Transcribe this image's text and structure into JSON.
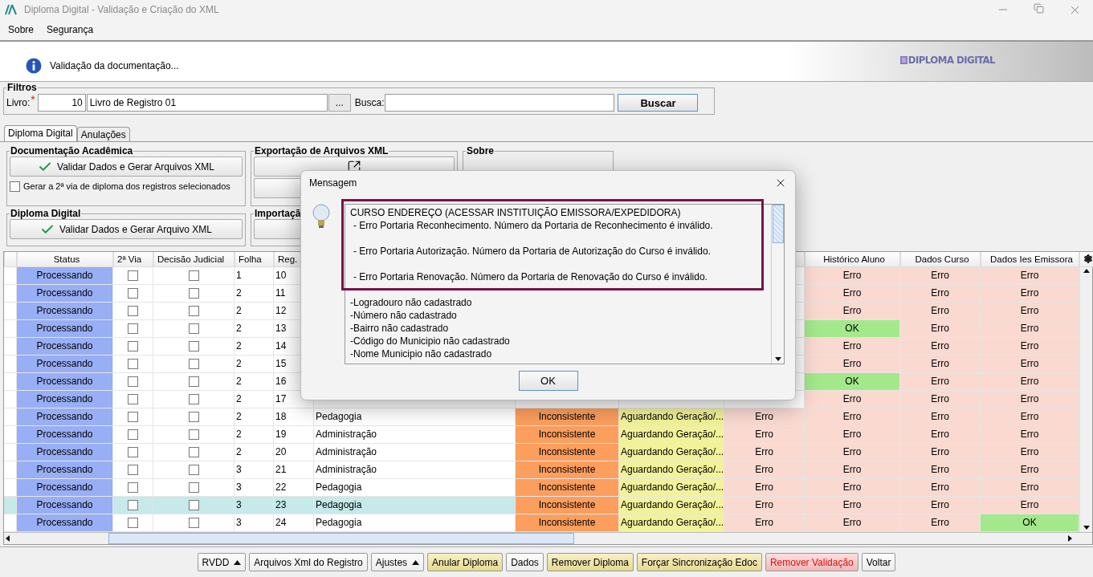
{
  "window": {
    "title": "Diploma Digital - Validação e Criação do XML"
  },
  "menu": [
    {
      "label": "Sobre"
    },
    {
      "label": "Segurança"
    }
  ],
  "banner": {
    "message": "Validação da documentação...",
    "logo": "DIPLOMA DIGITAL"
  },
  "filters": {
    "title": "Filtros",
    "book_label": "Livro:",
    "required_mark": "*",
    "book_code": "10",
    "book_name": "Livro de Registro 01",
    "browse_button": "...",
    "search_label": "Busca:",
    "search_button": "Buscar"
  },
  "tabs": [
    {
      "label": "Diploma Digital",
      "selected": true
    },
    {
      "label": "Anulações",
      "selected": false
    }
  ],
  "groups": {
    "academic": {
      "title": "Documentação Acadêmica",
      "button": "Validar Dados e Gerar Arquivos XML",
      "checkbox": {
        "label": "Gerar a 2ª via de diploma dos registros selecionados",
        "checked": false
      }
    },
    "digital": {
      "title": "Diploma Digital",
      "button": "Validar Dados e Gerar Arquivo XML"
    },
    "export": {
      "title": "Exportação de Arquivos XML"
    },
    "import": {
      "title": "Importaçã"
    },
    "about": {
      "title": "Sobre"
    }
  },
  "table": {
    "columns": [
      "Status",
      "2ª Via",
      "Decisão Judicial",
      "Folha",
      "Reg.",
      "Histórico Aluno",
      "Dados Curso",
      "Dados Ies Emissora"
    ],
    "rows": [
      {
        "status": "Processando",
        "via2": false,
        "judicial": false,
        "folha": "1",
        "reg": "10",
        "historico": {
          "text": "Erro",
          "ok": false
        },
        "dados_curso": {
          "text": "Erro",
          "ok": false
        },
        "dados_ies": {
          "text": "Erro",
          "ok": false
        },
        "selected": false
      },
      {
        "status": "Processando",
        "via2": false,
        "judicial": false,
        "folha": "2",
        "reg": "11",
        "historico": {
          "text": "Erro",
          "ok": false
        },
        "dados_curso": {
          "text": "Erro",
          "ok": false
        },
        "dados_ies": {
          "text": "Erro",
          "ok": false
        },
        "selected": false
      },
      {
        "status": "Processando",
        "via2": false,
        "judicial": false,
        "folha": "2",
        "reg": "12",
        "historico": {
          "text": "Erro",
          "ok": false
        },
        "dados_curso": {
          "text": "Erro",
          "ok": false
        },
        "dados_ies": {
          "text": "Erro",
          "ok": false
        },
        "selected": false
      },
      {
        "status": "Processando",
        "via2": false,
        "judicial": false,
        "folha": "2",
        "reg": "13",
        "historico": {
          "text": "OK",
          "ok": true
        },
        "dados_curso": {
          "text": "Erro",
          "ok": false
        },
        "dados_ies": {
          "text": "Erro",
          "ok": false
        },
        "selected": false
      },
      {
        "status": "Processando",
        "via2": false,
        "judicial": false,
        "folha": "2",
        "reg": "14",
        "historico": {
          "text": "Erro",
          "ok": false
        },
        "dados_curso": {
          "text": "Erro",
          "ok": false
        },
        "dados_ies": {
          "text": "Erro",
          "ok": false
        },
        "selected": false
      },
      {
        "status": "Processando",
        "via2": false,
        "judicial": false,
        "folha": "2",
        "reg": "15",
        "historico": {
          "text": "Erro",
          "ok": false
        },
        "dados_curso": {
          "text": "Erro",
          "ok": false
        },
        "dados_ies": {
          "text": "Erro",
          "ok": false
        },
        "selected": false
      },
      {
        "status": "Processando",
        "via2": false,
        "judicial": false,
        "folha": "2",
        "reg": "16",
        "historico": {
          "text": "OK",
          "ok": true
        },
        "dados_curso": {
          "text": "Erro",
          "ok": false
        },
        "dados_ies": {
          "text": "Erro",
          "ok": false
        },
        "selected": false
      },
      {
        "status": "Processando",
        "via2": false,
        "judicial": false,
        "folha": "2",
        "reg": "17",
        "historico": {
          "text": "Erro",
          "ok": false
        },
        "dados_curso": {
          "text": "Erro",
          "ok": false
        },
        "dados_ies": {
          "text": "Erro",
          "ok": false
        },
        "selected": false
      },
      {
        "status": "Processando",
        "via2": false,
        "judicial": false,
        "folha": "2",
        "reg": "18",
        "curso": "Pedagogia",
        "situacao": "Inconsistente",
        "geracao": "Aguardando Geração/...",
        "column_9": {
          "text": "Erro",
          "ok": false
        },
        "historico": {
          "text": "Erro",
          "ok": false
        },
        "dados_curso": {
          "text": "Erro",
          "ok": false
        },
        "dados_ies": {
          "text": "Erro",
          "ok": false
        },
        "selected": false
      },
      {
        "status": "Processando",
        "via2": false,
        "judicial": false,
        "folha": "2",
        "reg": "19",
        "curso": "Administração",
        "situacao": "Inconsistente",
        "geracao": "Aguardando Geração/...",
        "column_9": {
          "text": "Erro",
          "ok": false
        },
        "historico": {
          "text": "Erro",
          "ok": false
        },
        "dados_curso": {
          "text": "Erro",
          "ok": false
        },
        "dados_ies": {
          "text": "Erro",
          "ok": false
        },
        "selected": false
      },
      {
        "status": "Processando",
        "via2": false,
        "judicial": false,
        "folha": "2",
        "reg": "20",
        "curso": "Administração",
        "situacao": "Inconsistente",
        "geracao": "Aguardando Geração/...",
        "column_9": {
          "text": "Erro",
          "ok": false
        },
        "historico": {
          "text": "Erro",
          "ok": false
        },
        "dados_curso": {
          "text": "Erro",
          "ok": false
        },
        "dados_ies": {
          "text": "Erro",
          "ok": false
        },
        "selected": false
      },
      {
        "status": "Processando",
        "via2": false,
        "judicial": false,
        "folha": "3",
        "reg": "21",
        "curso": "Administração",
        "situacao": "Inconsistente",
        "geracao": "Aguardando Geração/...",
        "column_9": {
          "text": "Erro",
          "ok": false
        },
        "historico": {
          "text": "Erro",
          "ok": false
        },
        "dados_curso": {
          "text": "Erro",
          "ok": false
        },
        "dados_ies": {
          "text": "Erro",
          "ok": false
        },
        "selected": false
      },
      {
        "status": "Processando",
        "via2": false,
        "judicial": false,
        "folha": "3",
        "reg": "22",
        "curso": "Pedagogia",
        "situacao": "Inconsistente",
        "geracao": "Aguardando Geração/...",
        "column_9": {
          "text": "Erro",
          "ok": false
        },
        "historico": {
          "text": "Erro",
          "ok": false
        },
        "dados_curso": {
          "text": "Erro",
          "ok": false
        },
        "dados_ies": {
          "text": "Erro",
          "ok": false
        },
        "selected": false
      },
      {
        "status": "Processando",
        "via2": false,
        "judicial": false,
        "folha": "3",
        "reg": "23",
        "curso": "Pedagogia",
        "situacao": "Inconsistente",
        "geracao": "Aguardando Geração/...",
        "column_9": {
          "text": "Erro",
          "ok": false
        },
        "historico": {
          "text": "Erro",
          "ok": false
        },
        "dados_curso": {
          "text": "Erro",
          "ok": false
        },
        "dados_ies": {
          "text": "Erro",
          "ok": false
        },
        "selected": true
      },
      {
        "status": "Processando",
        "via2": false,
        "judicial": false,
        "folha": "3",
        "reg": "24",
        "curso": "Pedagogia",
        "situacao": "Inconsistente",
        "geracao": "Aguardando Geração/...",
        "column_9": {
          "text": "Erro",
          "ok": false
        },
        "historico": {
          "text": "Erro",
          "ok": false
        },
        "dados_curso": {
          "text": "Erro",
          "ok": false
        },
        "dados_ies": {
          "text": "OK",
          "ok": true
        },
        "selected": false
      }
    ]
  },
  "buttons": [
    {
      "label": "RVDD",
      "kind": "menu"
    },
    {
      "label": "Arquivos Xml do Registro",
      "kind": "plain"
    },
    {
      "label": "Ajustes",
      "kind": "menu"
    },
    {
      "label": "Anular Diploma",
      "kind": "warning"
    },
    {
      "label": "Dados",
      "kind": "plain"
    },
    {
      "label": "Remover Diploma",
      "kind": "warning"
    },
    {
      "label": "Forçar Sincronização Edoc",
      "kind": "warning"
    },
    {
      "label": "Remover Validação",
      "kind": "danger"
    },
    {
      "label": "Voltar",
      "kind": "plain"
    }
  ],
  "dialog": {
    "title": "Mensagem",
    "lines": [
      {
        "kind": "header",
        "text": "CURSO ENDEREÇO (ACESSAR INSTITUIÇÃO EMISSORA/EXPEDIDORA)"
      },
      {
        "kind": "error",
        "text": "- Erro Portaria Reconhecimento. Número da Portaria de Reconhecimento é inválido."
      },
      {
        "kind": "error",
        "text": "- Erro Portaria Autorização. Número da Portaria de Autorização do Curso é inválido."
      },
      {
        "kind": "error",
        "text": "- Erro Portaria Renovação. Número da Portaria de Renovação do Curso é inválido."
      },
      {
        "kind": "detail",
        "text": "-Logradouro não cadastrado"
      },
      {
        "kind": "detail",
        "text": "-Número não cadastrado"
      },
      {
        "kind": "detail",
        "text": "-Bairro não cadastrado"
      },
      {
        "kind": "detail",
        "text": "-Código do Municipio não cadastrado"
      },
      {
        "kind": "detail",
        "text": "-Nome Municipio não cadastrado"
      }
    ],
    "ok_button": "OK"
  }
}
